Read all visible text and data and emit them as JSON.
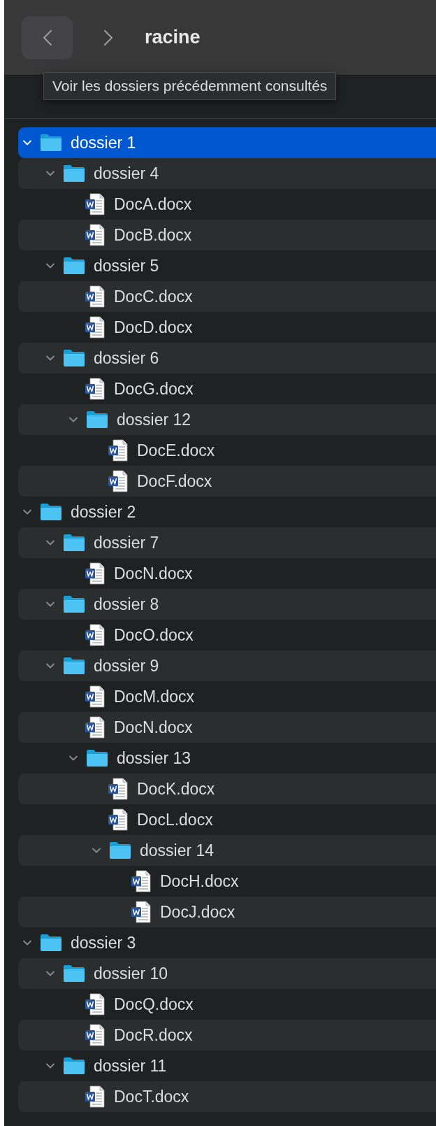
{
  "toolbar": {
    "title": "racine",
    "tooltip": "Voir les dossiers précédemment consultés"
  },
  "tree": [
    {
      "kind": "folder",
      "name": "dossier 1",
      "expanded": true,
      "selected": true,
      "children": [
        {
          "kind": "folder",
          "name": "dossier 4",
          "expanded": true,
          "selected": false,
          "children": [
            {
              "kind": "file",
              "name": "DocA.docx",
              "selected": false
            },
            {
              "kind": "file",
              "name": "DocB.docx",
              "selected": false
            }
          ]
        },
        {
          "kind": "folder",
          "name": "dossier 5",
          "expanded": true,
          "selected": false,
          "children": [
            {
              "kind": "file",
              "name": "DocC.docx",
              "selected": false
            },
            {
              "kind": "file",
              "name": "DocD.docx",
              "selected": false
            }
          ]
        },
        {
          "kind": "folder",
          "name": "dossier 6",
          "expanded": true,
          "selected": false,
          "children": [
            {
              "kind": "file",
              "name": "DocG.docx",
              "selected": false
            },
            {
              "kind": "folder",
              "name": "dossier 12",
              "expanded": true,
              "selected": false,
              "children": [
                {
                  "kind": "file",
                  "name": "DocE.docx",
                  "selected": false
                },
                {
                  "kind": "file",
                  "name": "DocF.docx",
                  "selected": false
                }
              ]
            }
          ]
        }
      ]
    },
    {
      "kind": "folder",
      "name": "dossier 2",
      "expanded": true,
      "selected": false,
      "children": [
        {
          "kind": "folder",
          "name": "dossier 7",
          "expanded": true,
          "selected": false,
          "children": [
            {
              "kind": "file",
              "name": "DocN.docx",
              "selected": false
            }
          ]
        },
        {
          "kind": "folder",
          "name": "dossier 8",
          "expanded": true,
          "selected": false,
          "children": [
            {
              "kind": "file",
              "name": "DocO.docx",
              "selected": false
            }
          ]
        },
        {
          "kind": "folder",
          "name": "dossier 9",
          "expanded": true,
          "selected": false,
          "children": [
            {
              "kind": "file",
              "name": "DocM.docx",
              "selected": false
            },
            {
              "kind": "file",
              "name": "DocN.docx",
              "selected": false
            },
            {
              "kind": "folder",
              "name": "dossier 13",
              "expanded": true,
              "selected": false,
              "children": [
                {
                  "kind": "file",
                  "name": "DocK.docx",
                  "selected": false
                },
                {
                  "kind": "file",
                  "name": "DocL.docx",
                  "selected": false
                },
                {
                  "kind": "folder",
                  "name": "dossier 14",
                  "expanded": true,
                  "selected": false,
                  "children": [
                    {
                      "kind": "file",
                      "name": "DocH.docx",
                      "selected": false
                    },
                    {
                      "kind": "file",
                      "name": "DocJ.docx",
                      "selected": false
                    }
                  ]
                }
              ]
            }
          ]
        }
      ]
    },
    {
      "kind": "folder",
      "name": "dossier 3",
      "expanded": true,
      "selected": false,
      "children": [
        {
          "kind": "folder",
          "name": "dossier 10",
          "expanded": true,
          "selected": false,
          "children": [
            {
              "kind": "file",
              "name": "DocQ.docx",
              "selected": false
            },
            {
              "kind": "file",
              "name": "DocR.docx",
              "selected": false
            }
          ]
        },
        {
          "kind": "folder",
          "name": "dossier 11",
          "expanded": true,
          "selected": false,
          "children": [
            {
              "kind": "file",
              "name": "DocT.docx",
              "selected": false
            }
          ]
        }
      ]
    }
  ]
}
